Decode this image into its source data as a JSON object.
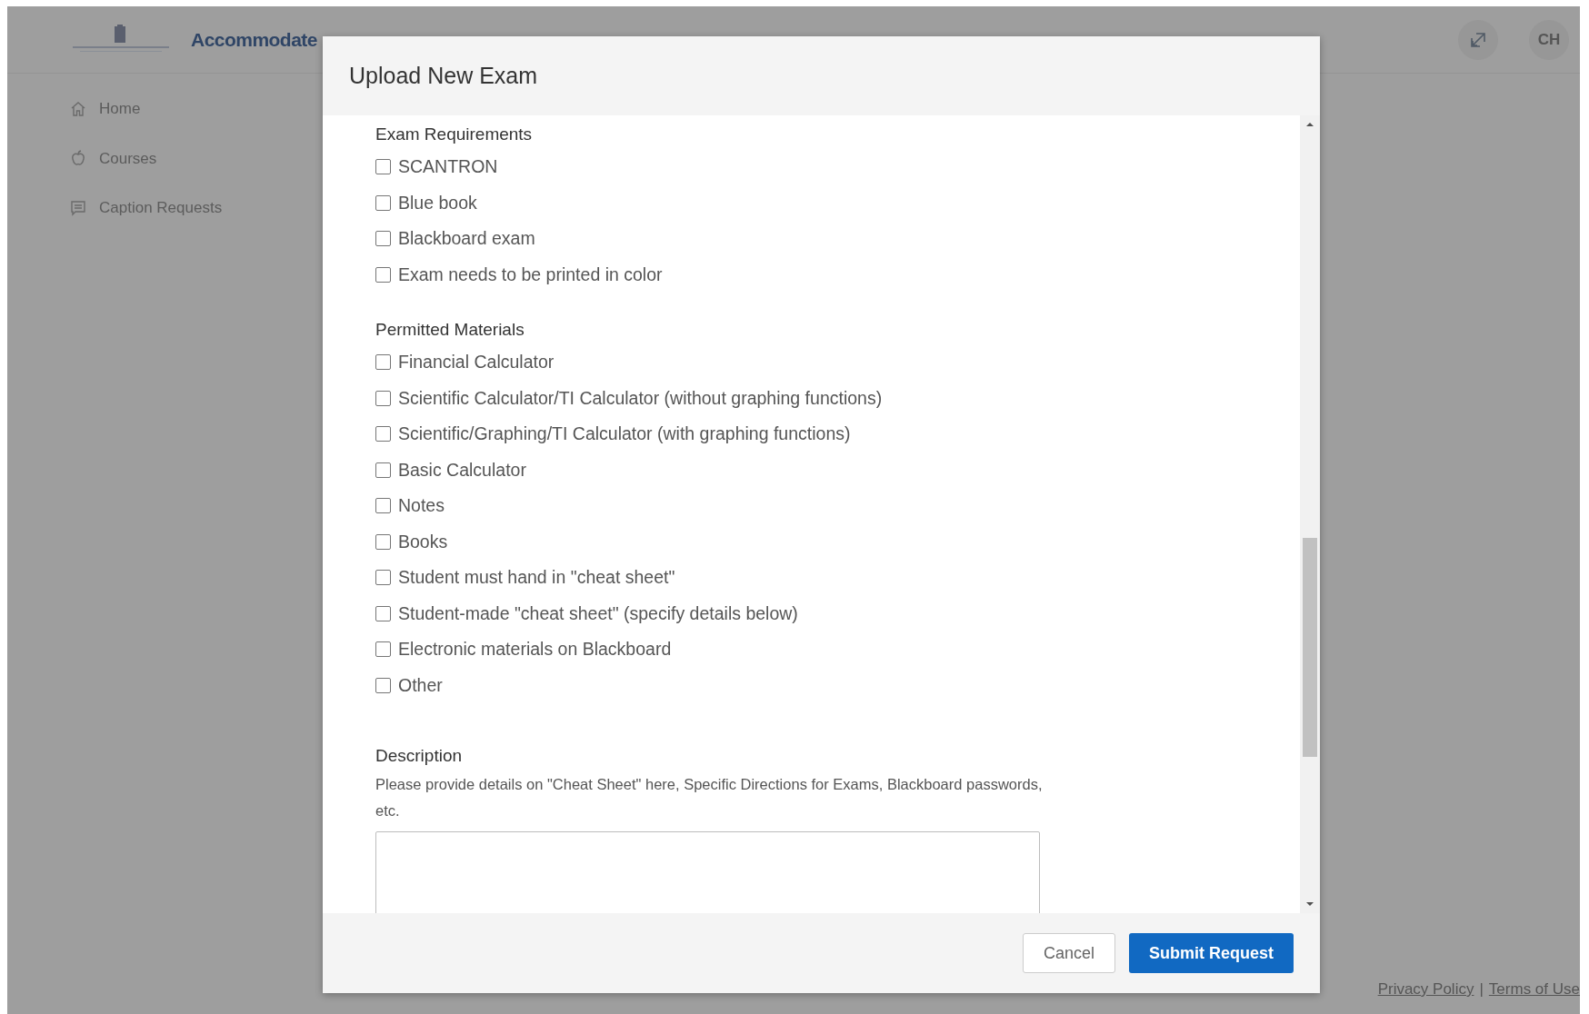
{
  "header": {
    "logo_text": "Accommodate",
    "avatar": "CH"
  },
  "sidebar": {
    "items": [
      {
        "label": "Home",
        "kind": "home"
      },
      {
        "label": "Courses",
        "kind": "courses"
      },
      {
        "label": "Caption Requests",
        "kind": "captions"
      }
    ]
  },
  "dialog": {
    "title": "Upload New Exam",
    "sections": [
      {
        "heading": "Exam Requirements",
        "options": [
          {
            "label": "SCANTRON",
            "checked": false
          },
          {
            "label": "Blue book",
            "checked": false
          },
          {
            "label": "Blackboard exam",
            "checked": false
          },
          {
            "label": "Exam needs to be printed in color",
            "checked": false
          }
        ]
      },
      {
        "heading": "Permitted Materials",
        "options": [
          {
            "label": "Financial Calculator",
            "checked": false
          },
          {
            "label": "Scientific Calculator/TI Calculator (without graphing functions)",
            "checked": false
          },
          {
            "label": "Scientific/Graphing/TI Calculator (with graphing functions)",
            "checked": false
          },
          {
            "label": "Basic Calculator",
            "checked": false
          },
          {
            "label": "Notes",
            "checked": false
          },
          {
            "label": "Books",
            "checked": false
          },
          {
            "label": "Student must hand in \"cheat sheet\"",
            "checked": false
          },
          {
            "label": "Student-made \"cheat sheet\" (specify details below)",
            "checked": false
          },
          {
            "label": "Electronic materials on Blackboard",
            "checked": false
          },
          {
            "label": "Other",
            "checked": false
          }
        ]
      }
    ],
    "description": {
      "label": "Description",
      "help": "Please provide details on \"Cheat Sheet\" here, Specific Directions for Exams, Blackboard passwords, etc."
    },
    "buttons": [
      {
        "label": "Cancel",
        "kind": "secondary"
      },
      {
        "label": "Submit Request",
        "kind": "primary"
      }
    ]
  },
  "footer": {
    "links": [
      "Privacy Policy",
      "Terms of Use"
    ],
    "separator": "|"
  }
}
